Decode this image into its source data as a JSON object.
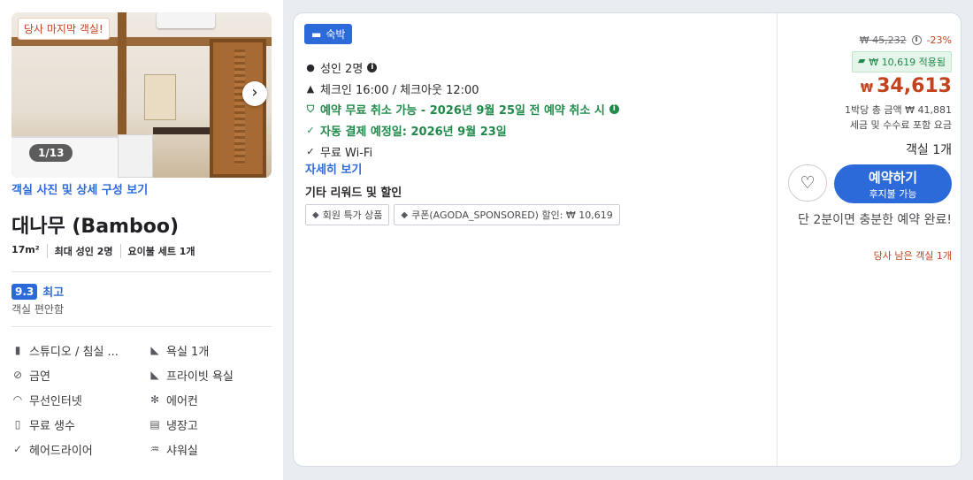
{
  "left": {
    "photo": {
      "promo_tag": "당사 마지막 객실!",
      "counter": "1/13",
      "next_icon": "chevron-right-icon"
    },
    "photo_link": "객실 사진 및 상세 구성 보기",
    "room_name": "대나무 (Bamboo)",
    "specs": [
      "17m²",
      "최대 성인 2명",
      "요이불 세트 1개"
    ],
    "rating": {
      "score": "9.3",
      "label": "최고",
      "sub": "객실 편안함"
    },
    "amenities": [
      {
        "icon": "book-icon",
        "label": "스튜디오 / 침실 ..."
      },
      {
        "icon": "bathtub-icon",
        "label": "욕실 1개"
      },
      {
        "icon": "no-smoking-icon",
        "label": "금연"
      },
      {
        "icon": "bathtub-icon",
        "label": "프라이빗 욕실"
      },
      {
        "icon": "wifi-icon",
        "label": "무선인터넷"
      },
      {
        "icon": "fan-icon",
        "label": "에어컨"
      },
      {
        "icon": "water-bottle-icon",
        "label": "무료 생수"
      },
      {
        "icon": "fridge-icon",
        "label": "냉장고"
      },
      {
        "icon": "check-icon",
        "label": "헤어드라이어"
      },
      {
        "icon": "shower-icon",
        "label": "샤워실"
      }
    ]
  },
  "offer": {
    "stay_badge": "숙박",
    "guests": "성인 2명",
    "checkin": "체크인 16:00 / 체크아웃 12:00",
    "free_cancel": "예약 무료 취소 가능 - 2026년 9월 25일 전 예약 취소 시",
    "auto_payment": "자동 결제 예정일: 2026년 9월 23일",
    "wifi": "무료 Wi-Fi",
    "details_link": "자세히 보기",
    "rewards_title": "기타 리워드 및 할인",
    "chips": [
      "회원 특가 상품",
      "쿠폰(AGODA_SPONSORED) 할인: ₩ 10,619"
    ]
  },
  "pricing": {
    "original_price": "₩ 45,232",
    "discount": "-23%",
    "applied": "₩ 10,619 적용됨",
    "currency": "₩",
    "price": "34,613",
    "total_line": "1박당 총 금액 ₩ 41,881",
    "tax_line": "세금 및 수수료 포함 요금",
    "rooms_left": "객실 1개",
    "book_label": "예약하기",
    "book_sub": "후지불 가능",
    "urgency": "단 2분이면 충분한 예약 완료!",
    "last_room": "당사 남은 객실 1개"
  },
  "colors": {
    "brand_blue": "#2d6ad9",
    "price_red": "#c1441f",
    "green": "#218a4a"
  }
}
